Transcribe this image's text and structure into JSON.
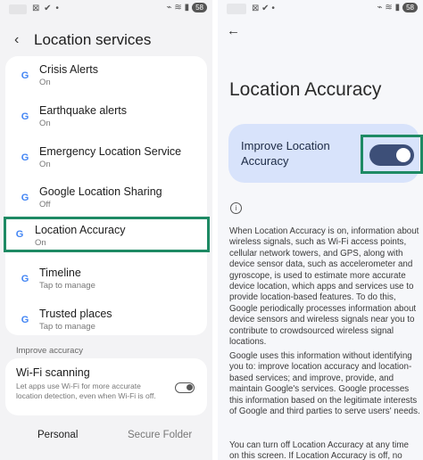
{
  "left_status": {
    "icons": "⊠ ✔ •",
    "right_icons": "⌁ ≋ ▮",
    "battery": "58"
  },
  "left_header": {
    "back": "‹",
    "title": "Location services"
  },
  "items": [
    {
      "title": "Crisis Alerts",
      "sub": "On"
    },
    {
      "title": "Earthquake alerts",
      "sub": "On"
    },
    {
      "title": "Emergency Location Service",
      "sub": "On"
    },
    {
      "title": "Google Location Sharing",
      "sub": "Off"
    },
    {
      "title": "Location Accuracy",
      "sub": "On"
    },
    {
      "title": "Timeline",
      "sub": "Tap to manage"
    },
    {
      "title": "Trusted places",
      "sub": "Tap to manage"
    }
  ],
  "g_letter": "G",
  "improve_section": {
    "label": "Improve accuracy",
    "wifi_title": "Wi-Fi scanning",
    "wifi_desc": "Let apps use Wi-Fi for more accurate location detection, even when Wi-Fi is off.",
    "wifi_on": false
  },
  "tabs": {
    "personal": "Personal",
    "secure": "Secure Folder"
  },
  "right_status": {
    "icons": "⊠ ✔ •",
    "right_icons": "⌁ ≋ ▮",
    "battery": "58"
  },
  "right_header": {
    "back": "←",
    "title": "Location Accuracy"
  },
  "improve_card": {
    "label": "Improve Location Accuracy",
    "toggle_on": true
  },
  "info_glyph": "i",
  "paragraphs": {
    "p1": "When Location Accuracy is on, information about wireless signals, such as Wi-Fi access points, cellular network towers, and GPS, along with device sensor data, such as accelerometer and gyroscope, is used to estimate more accurate device location, which apps and services use to provide location-based features. To do this, Google periodically processes information about device sensors and wireless signals near you to contribute to crowdsourced wireless signal locations.",
    "p2": "Google uses this information without identifying you to: improve location accuracy and location-based services; and improve, provide, and maintain Google's services. Google processes this information based on the legitimate interests of Google and third parties to serve users' needs.",
    "p3": "You can turn off Location Accuracy at any time on this screen. If Location Accuracy is off, no"
  },
  "colors": {
    "highlight": "#1e8a64",
    "toggle_track": "#3d4f78",
    "card_bg": "#d8e3fb"
  }
}
